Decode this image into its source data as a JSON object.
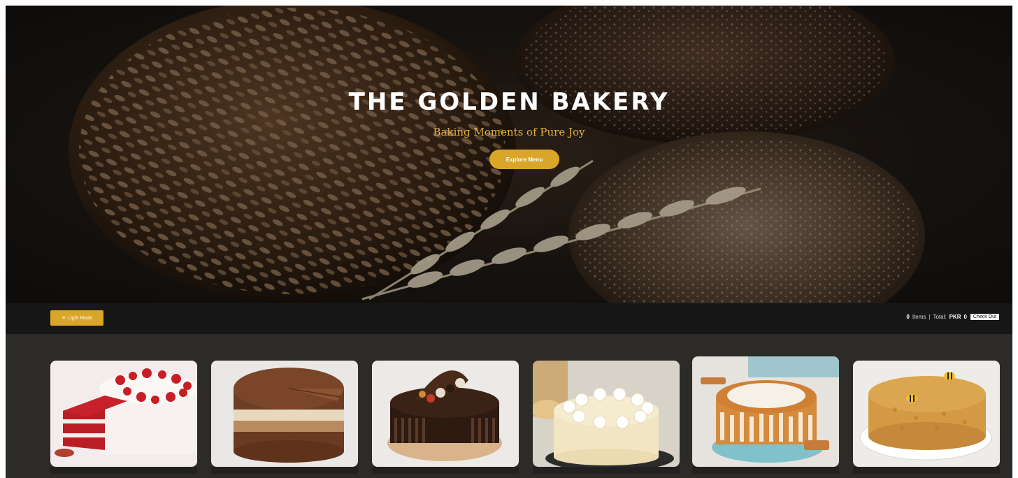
{
  "hero": {
    "title": "THE GOLDEN BAKERY",
    "tagline": "Baking Moments of Pure Joy",
    "cta_label": "Explore Menu"
  },
  "toolbar": {
    "mode_icon": "sun-icon",
    "mode_label": "Light Mode",
    "cart": {
      "items_count": "0",
      "items_label": "Items",
      "separator": "|",
      "total_label": "Total:",
      "currency": "PKR",
      "total_value": "0",
      "checkout_label": "Check Out"
    }
  },
  "products": [
    {
      "name": "red-velvet-cake"
    },
    {
      "name": "chocolate-mousse-cake"
    },
    {
      "name": "chocolate-ganache-cake"
    },
    {
      "name": "white-chocolate-cake"
    },
    {
      "name": "caramel-drip-cake"
    },
    {
      "name": "honey-cake"
    }
  ],
  "colors": {
    "accent": "#d9a62a",
    "tagline": "#e3b23c",
    "toolbar_bg": "#171717",
    "products_bg": "#2c2b28"
  }
}
